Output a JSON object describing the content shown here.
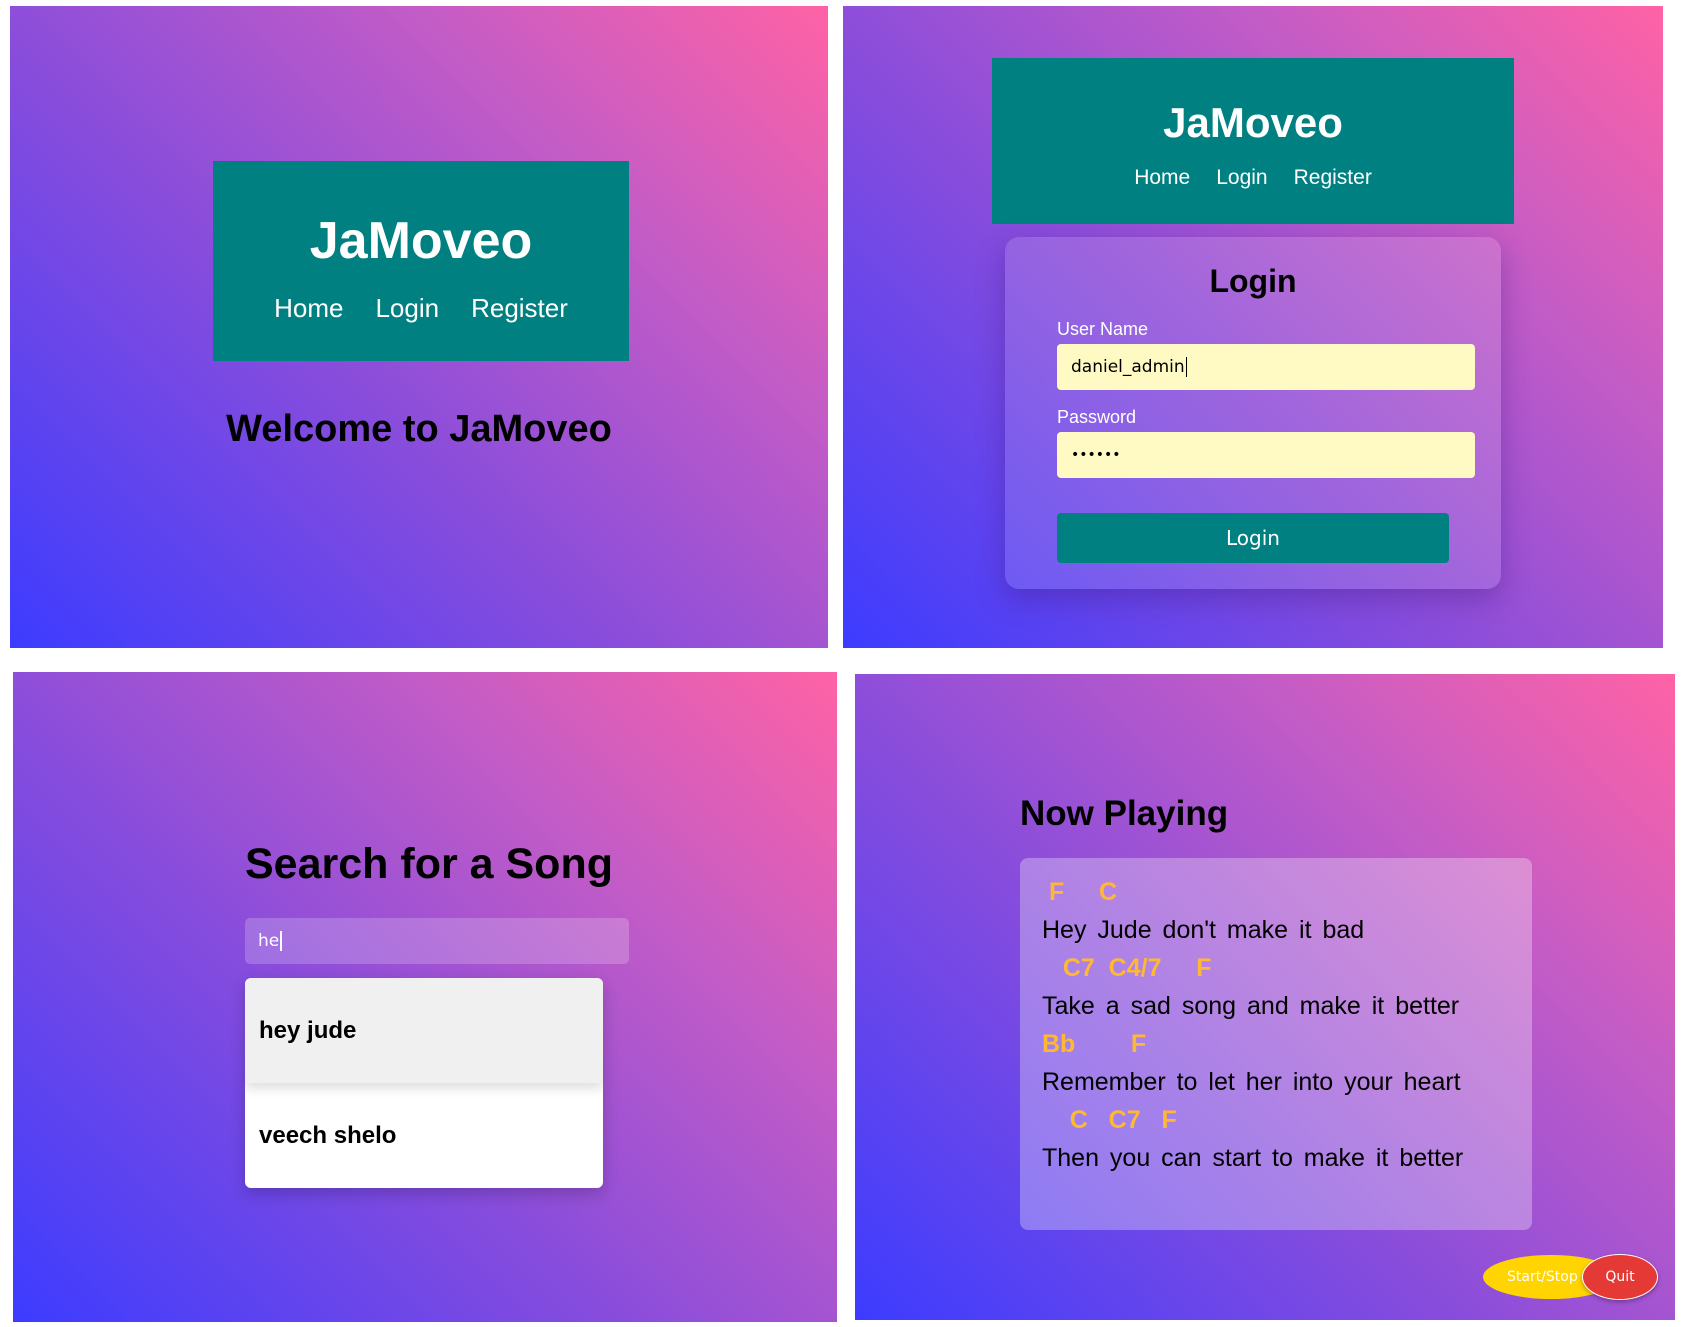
{
  "screens": {
    "home": {
      "brand": "JaMoveo",
      "nav": [
        "Home",
        "Login",
        "Register"
      ],
      "welcome": "Welcome to JaMoveo"
    },
    "login": {
      "brand": "JaMoveo",
      "nav": [
        "Home",
        "Login",
        "Register"
      ],
      "title": "Login",
      "username_label": "User Name",
      "username_value": "daniel_admin",
      "password_label": "Password",
      "password_value": "••••••",
      "submit_label": "Login"
    },
    "search": {
      "title": "Search for a Song",
      "query": "he",
      "results": [
        "hey jude",
        "veech shelo"
      ]
    },
    "live": {
      "title": "Now Playing",
      "lines": [
        {
          "chords": " F     C",
          "lyrics": "Hey Jude don't make it bad"
        },
        {
          "chords": "   C7  C4/7     F",
          "lyrics": "Take a sad song and make it better"
        },
        {
          "chords": "Bb        F",
          "lyrics": "Remember to let her into your heart"
        },
        {
          "chords": "    C   C7   F",
          "lyrics": "Then you can start to make it better"
        }
      ],
      "start_stop_label": "Start/Stop Scroll",
      "quit_label": "Quit"
    }
  },
  "colors": {
    "navbar": "#008080",
    "input_bg": "#fff9c4",
    "chord": "#ffb833",
    "quit": "#e53935",
    "start": "#ffd400",
    "gradient": [
      "#3c3cff",
      "#8a4ddb",
      "#ff62a5"
    ]
  }
}
